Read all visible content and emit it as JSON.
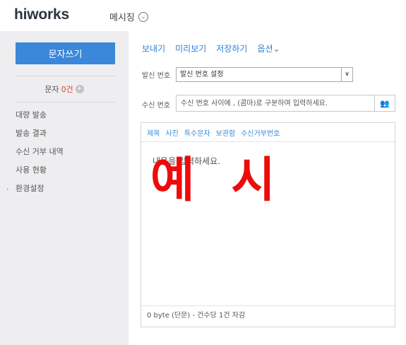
{
  "header": {
    "logo_text": "hiworks",
    "menu_label": "메시징",
    "menu_icon": "chevron-down-circle-icon"
  },
  "sidebar": {
    "write_button": "문자쓰기",
    "sms_label": "문자",
    "sms_count": "0건",
    "add_icon": "plus-circle-icon",
    "items": [
      {
        "label": "대량 발송"
      },
      {
        "label": "발송 결과"
      },
      {
        "label": "수신 거부 내역"
      },
      {
        "label": "사용 현황"
      },
      {
        "label": "환경설정",
        "arrow": "›"
      }
    ]
  },
  "toolbar": {
    "send": "보내기",
    "preview": "미리보기",
    "save": "저장하기",
    "options": "옵션",
    "options_icon": "⌄"
  },
  "form": {
    "sender_label": "발신 번호",
    "sender_value": "발신 번호 설정",
    "sender_dropdown_icon": "∨",
    "recipient_label": "수신 번호",
    "recipient_placeholder": "수신 번호 사이에 , (콤마)로 구분하여 입력하세요.",
    "contacts_icon": "👥"
  },
  "message": {
    "tabs": [
      "제목",
      "사진",
      "특수문자",
      "보관함",
      "수신거부번호"
    ],
    "placeholder": "내용을 입력하세요.",
    "footer": "0 byte (단문) - 건수당 1건 차감",
    "watermark": "예 시"
  },
  "colors": {
    "accent": "#3b87d9",
    "link": "#2f7fd3",
    "count_red": "#e0402b",
    "watermark": "#ee0b0b",
    "sidebar_bg": "#eeeef0"
  }
}
